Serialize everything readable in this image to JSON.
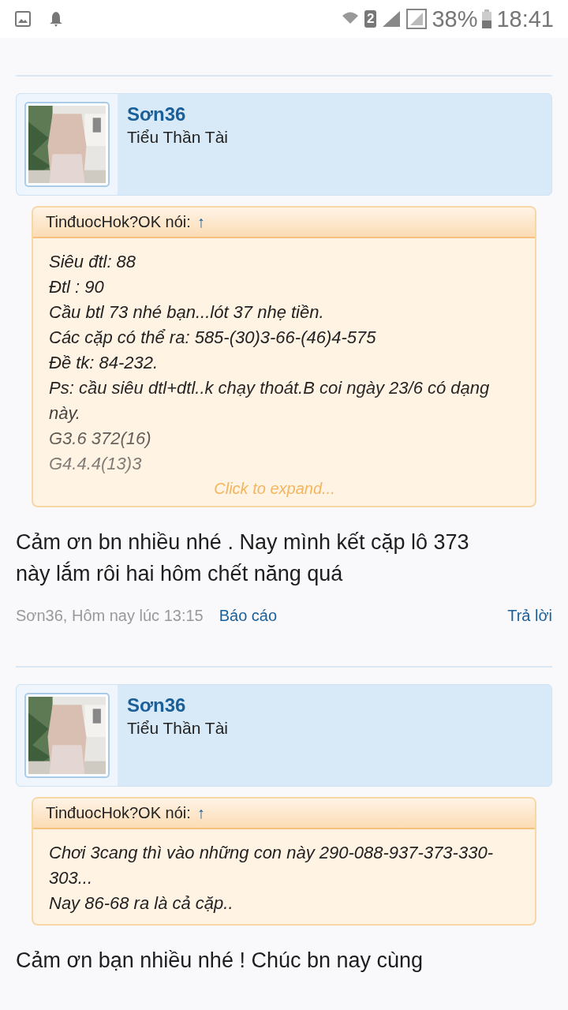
{
  "status_bar": {
    "battery": "38%",
    "time": "18:41",
    "sim_badge": "2"
  },
  "posts": [
    {
      "user": {
        "name": "Sơn36",
        "title": "Tiểu Thần Tài"
      },
      "quote": {
        "author": "TinđuocHok?OK nói:",
        "arrow": "↑",
        "collapsed": true,
        "lines": [
          "Siêu đtl: 88",
          "Đtl : 90",
          "Cầu btl 73 nhé bạn...lót 37 nhẹ tiền.",
          "Các cặp có thể ra: 585-(30)3-66-(46)4-575",
          "Đề tk: 84-232.",
          "Ps: cầu siêu dtl+dtl..k chạy thoát.B coi ngày 23/6 có dạng này.",
          "G3.6 372(16)",
          "G4.4.4(13)3"
        ],
        "expand_label": "Click to expand..."
      },
      "message": "Cảm ơn bn nhiều nhé . Nay mình kết cặp lô 373 này lắm rôi hai hôm chết năng quá",
      "meta": "Sơn36, Hôm nay lúc 13:15",
      "report": "Báo cáo",
      "reply": "Trả lời"
    },
    {
      "user": {
        "name": "Sơn36",
        "title": "Tiểu Thần Tài"
      },
      "quote": {
        "author": "TinđuocHok?OK nói:",
        "arrow": "↑",
        "collapsed": false,
        "lines": [
          "Chơi 3cang thì vào những con này 290-088-937-373-330-303...",
          "Nay 86-68 ra là cả cặp.."
        ]
      },
      "message": "Cảm ơn bạn nhiều nhé ! Chúc bn nay cùng"
    }
  ]
}
